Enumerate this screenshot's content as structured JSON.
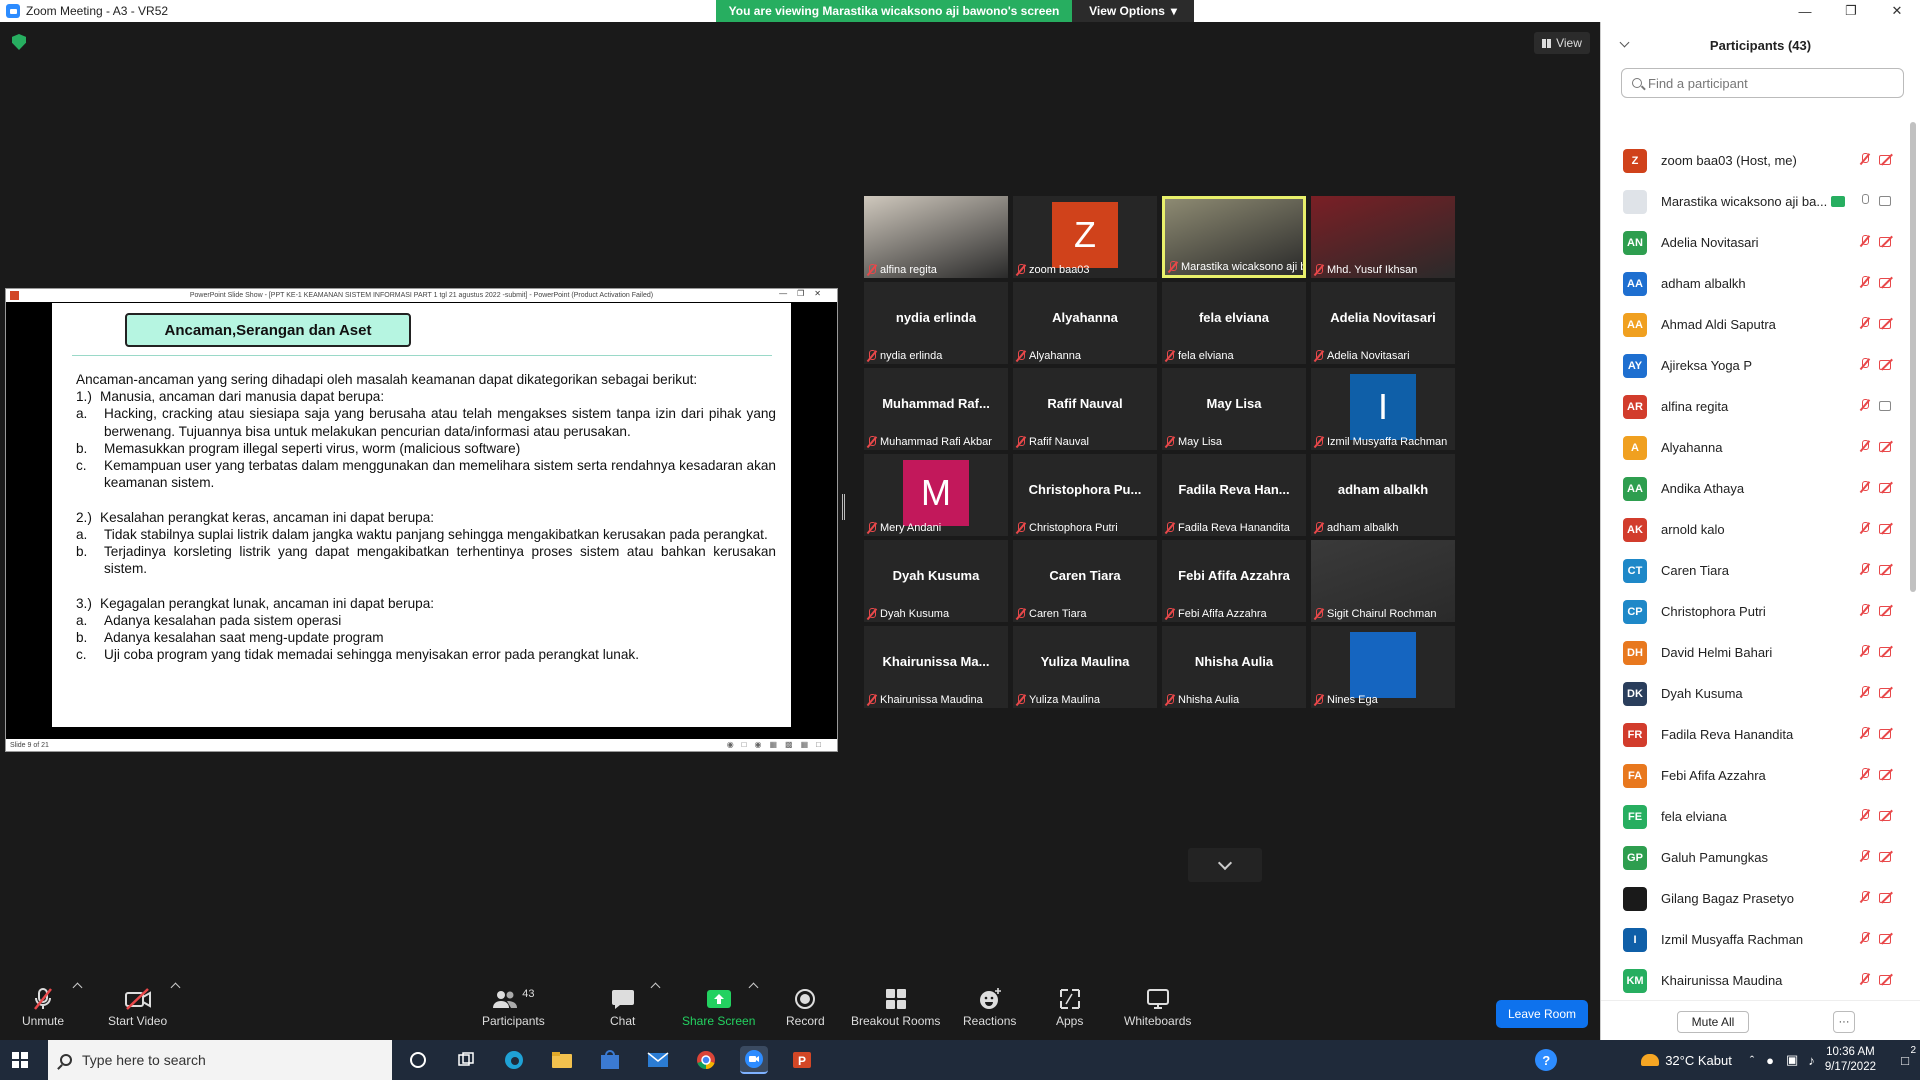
{
  "window": {
    "title": "Zoom Meeting - A3 - VR52",
    "banner_text": "You are viewing Marastika wicaksono aji bawono's screen",
    "view_options": "View Options",
    "view_label": "View"
  },
  "shared_screen": {
    "window_title": "PowerPoint Slide Show - [PPT KE-1 KEAMANAN SISTEM INFORMASI PART 1 tgl 21 agustus 2022 -submit] - PowerPoint (Product Activation Failed)",
    "slide_status": "Slide 9 of 21",
    "slide_title": "Ancaman,Serangan dan Aset",
    "intro": "Ancaman-ancaman yang sering dihadapi oleh masalah keamanan dapat dikategorikan sebagai berikut:",
    "sections": [
      {
        "num": "1.)",
        "head": "Manusia, ancaman dari manusia dapat berupa:",
        "items": [
          {
            "n": "a.",
            "t": "Hacking, cracking atau siesiapa saja yang berusaha atau telah mengakses sistem tanpa izin dari pihak yang berwenang. Tujuannya bisa untuk melakukan pencurian data/informasi atau perusakan."
          },
          {
            "n": "b.",
            "t": "Memasukkan program illegal seperti virus, worm (malicious software)"
          },
          {
            "n": "c.",
            "t": "Kemampuan user yang terbatas dalam menggunakan dan memelihara sistem serta rendahnya kesadaran akan keamanan sistem."
          }
        ]
      },
      {
        "num": "2.)",
        "head": "Kesalahan perangkat keras, ancaman ini dapat berupa:",
        "items": [
          {
            "n": "a.",
            "t": "Tidak stabilnya suplai listrik dalam jangka waktu panjang sehingga mengakibatkan kerusakan pada perangkat."
          },
          {
            "n": "b.",
            "t": "Terjadinya korsleting listrik yang dapat mengakibatkan terhentinya proses sistem atau bahkan kerusakan sistem."
          }
        ]
      },
      {
        "num": "3.)",
        "head": "Kegagalan perangkat lunak, ancaman ini dapat berupa:",
        "items": [
          {
            "n": "a.",
            "t": "Adanya kesalahan pada sistem operasi"
          },
          {
            "n": "b.",
            "t": "Adanya kesalahan saat meng-update program"
          },
          {
            "n": "c.",
            "t": "Uji coba program yang tidak memadai sehingga menyisakan error pada perangkat lunak."
          }
        ]
      }
    ]
  },
  "tiles": [
    {
      "label": "alfina regita",
      "kind": "photo",
      "photo_color": "#cfc8bd"
    },
    {
      "label": "zoom baa03",
      "kind": "avatar",
      "letter": "Z",
      "color": "#d0421b"
    },
    {
      "label": "Marastika wicaksono aji ba...",
      "kind": "photo",
      "photo_color": "#8d8a72",
      "active": true
    },
    {
      "label": "Mhd. Yusuf Ikhsan",
      "kind": "photo",
      "photo_color": "#7a1f25"
    },
    {
      "label": "nydia erlinda",
      "big": "nydia erlinda",
      "kind": "name"
    },
    {
      "label": "Alyahanna",
      "big": "Alyahanna",
      "kind": "name"
    },
    {
      "label": "fela elviana",
      "big": "fela elviana",
      "kind": "name"
    },
    {
      "label": "Adelia Novitasari",
      "big": "Adelia Novitasari",
      "kind": "name"
    },
    {
      "label": "Muhammad Rafi Akbar",
      "big": "Muhammad Raf...",
      "kind": "name"
    },
    {
      "label": "Rafif Nauval",
      "big": "Rafif Nauval",
      "kind": "name"
    },
    {
      "label": "May Lisa",
      "big": "May Lisa",
      "kind": "name"
    },
    {
      "label": "Izmil Musyaffa Rachman",
      "kind": "avatar",
      "letter": "I",
      "color": "#0f5fa8"
    },
    {
      "label": "Mery Andani",
      "kind": "avatar",
      "letter": "M",
      "color": "#c2185b"
    },
    {
      "label": "Christophora Putri",
      "big": "Christophora Pu...",
      "kind": "name"
    },
    {
      "label": "Fadila Reva Hanandita",
      "big": "Fadila Reva Han...",
      "kind": "name"
    },
    {
      "label": "adham albalkh",
      "big": "adham albalkh",
      "kind": "name"
    },
    {
      "label": "Dyah Kusuma",
      "big": "Dyah Kusuma",
      "kind": "name"
    },
    {
      "label": "Caren Tiara",
      "big": "Caren Tiara",
      "kind": "name"
    },
    {
      "label": "Febi Afifa Azzahra",
      "big": "Febi Afifa Azzahra",
      "kind": "name"
    },
    {
      "label": "Sigit Chairul Rochman",
      "kind": "photo",
      "photo_color": "#3a3a3a"
    },
    {
      "label": "Khairunissa Maudina",
      "big": "Khairunissa Ma...",
      "kind": "name"
    },
    {
      "label": "Yuliza Maulina",
      "big": "Yuliza Maulina",
      "kind": "name"
    },
    {
      "label": "Nhisha Aulia",
      "big": "Nhisha Aulia",
      "kind": "name"
    },
    {
      "label": "Nines Ega",
      "kind": "avatar",
      "letter": "",
      "color": "#1565c0"
    }
  ],
  "toolbar": {
    "unmute": "Unmute",
    "start_video": "Start Video",
    "participants": "Participants",
    "participants_count": "43",
    "chat": "Chat",
    "share_screen": "Share Screen",
    "record": "Record",
    "breakout_rooms": "Breakout Rooms",
    "reactions": "Reactions",
    "apps": "Apps",
    "whiteboards": "Whiteboards",
    "leave_room": "Leave Room"
  },
  "panel": {
    "title": "Participants (43)",
    "search_placeholder": "Find a participant",
    "mute_all": "Mute All",
    "more": "···",
    "participants": [
      {
        "initials": "Z",
        "name": "zoom baa03 (Host, me)",
        "color": "#d0421b"
      },
      {
        "initials": "",
        "name": "Marastika wicaksono aji ba...",
        "color": "#dfe3e8",
        "sharing": true,
        "video_on": true
      },
      {
        "initials": "AN",
        "name": "Adelia Novitasari",
        "color": "#2e9e4f"
      },
      {
        "initials": "AA",
        "name": "adham albalkh",
        "color": "#1e6fd0"
      },
      {
        "initials": "AA",
        "name": "Ahmad Aldi Saputra",
        "color": "#f0a020"
      },
      {
        "initials": "AY",
        "name": "Ajireksa Yoga P",
        "color": "#1e6fd0"
      },
      {
        "initials": "AR",
        "name": "alfina regita",
        "color": "#d23c2c",
        "video_on": true
      },
      {
        "initials": "A",
        "name": "Alyahanna",
        "color": "#f0a020"
      },
      {
        "initials": "AA",
        "name": "Andika Athaya",
        "color": "#2e9e4f"
      },
      {
        "initials": "AK",
        "name": "arnold kalo",
        "color": "#d23c2c"
      },
      {
        "initials": "CT",
        "name": "Caren Tiara",
        "color": "#1e88c8"
      },
      {
        "initials": "CP",
        "name": "Christophora Putri",
        "color": "#1e88c8"
      },
      {
        "initials": "DH",
        "name": "David Helmi Bahari",
        "color": "#e8781e"
      },
      {
        "initials": "DK",
        "name": "Dyah Kusuma",
        "color": "#2a3e5c"
      },
      {
        "initials": "FR",
        "name": "Fadila Reva Hanandita",
        "color": "#d23c2c"
      },
      {
        "initials": "FA",
        "name": "Febi Afifa Azzahra",
        "color": "#e8781e"
      },
      {
        "initials": "FE",
        "name": "fela elviana",
        "color": "#27ae60"
      },
      {
        "initials": "GP",
        "name": "Galuh Pamungkas",
        "color": "#2e9e4f"
      },
      {
        "initials": "",
        "name": "Gilang Bagaz Prasetyo",
        "color": "#1a1a1a"
      },
      {
        "initials": "I",
        "name": "Izmil Musyaffa Rachman",
        "color": "#0f5fa8"
      },
      {
        "initials": "KM",
        "name": "Khairunissa Maudina",
        "color": "#27ae60"
      }
    ]
  },
  "taskbar": {
    "search_placeholder": "Type here to search",
    "weather": "32°C  Kabut",
    "time": "10:36 AM",
    "date": "9/17/2022",
    "notifications": "2"
  }
}
